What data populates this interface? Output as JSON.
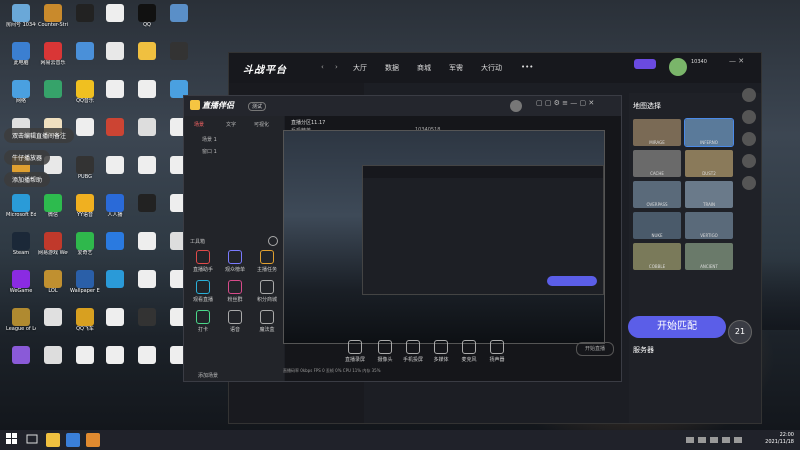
{
  "desktop": {
    "icons": [
      {
        "label": "房间号 10340",
        "color": "#6aa8d8"
      },
      {
        "label": "Counter-Strike Global Off.",
        "color": "#c98a2c"
      },
      {
        "label": "",
        "color": "#222"
      },
      {
        "label": "",
        "color": "#eee"
      },
      {
        "label": "QQ",
        "color": "#111"
      },
      {
        "label": "",
        "color": "#5a8fc8"
      },
      {
        "label": "此电脑",
        "color": "#3b7fd1"
      },
      {
        "label": "网易云音乐",
        "color": "#d93636"
      },
      {
        "label": "",
        "color": "#4a90d9"
      },
      {
        "label": "",
        "color": "#e8e8e8"
      },
      {
        "label": "",
        "color": "#f0c040"
      },
      {
        "label": "",
        "color": "#333"
      },
      {
        "label": "网络",
        "color": "#4aa0e0"
      },
      {
        "label": "",
        "color": "#36a36a"
      },
      {
        "label": "QQ音乐",
        "color": "#f0c020"
      },
      {
        "label": "",
        "color": "#eee"
      },
      {
        "label": "",
        "color": "#eee"
      },
      {
        "label": "",
        "color": "#4aa0e0"
      },
      {
        "label": "",
        "color": "#e0e0e0"
      },
      {
        "label": "",
        "color": "#f0e0c0"
      },
      {
        "label": "",
        "color": "#eee"
      },
      {
        "label": "",
        "color": "#c43"
      },
      {
        "label": "",
        "color": "#ddd"
      },
      {
        "label": "",
        "color": "#eee"
      },
      {
        "label": "",
        "color": "#e0a030"
      },
      {
        "label": "",
        "color": "#e8e8e8"
      },
      {
        "label": "PUBG",
        "color": "#333"
      },
      {
        "label": "",
        "color": "#eee"
      },
      {
        "label": "",
        "color": "#eee"
      },
      {
        "label": "",
        "color": "#eee"
      },
      {
        "label": "Microsoft Edge",
        "color": "#2a9bd8"
      },
      {
        "label": "微信",
        "color": "#2dbb4e"
      },
      {
        "label": "YY语音",
        "color": "#f0b020"
      },
      {
        "label": "人人播",
        "color": "#2a6ad8"
      },
      {
        "label": "",
        "color": "#222"
      },
      {
        "label": "",
        "color": "#eee"
      },
      {
        "label": "Steam",
        "color": "#1b2838"
      },
      {
        "label": "网易游戏 WeGame",
        "color": "#c0392b"
      },
      {
        "label": "爱奇艺",
        "color": "#2fb84c"
      },
      {
        "label": "",
        "color": "#2a7ae0"
      },
      {
        "label": "",
        "color": "#eee"
      },
      {
        "label": "",
        "color": "#ddd"
      },
      {
        "label": "WeGame",
        "color": "#8a2be2"
      },
      {
        "label": "LOL",
        "color": "#c09030"
      },
      {
        "label": "Wallpaper Engine",
        "color": "#2a5fa8"
      },
      {
        "label": "",
        "color": "#2a9ad8"
      },
      {
        "label": "",
        "color": "#eee"
      },
      {
        "label": "",
        "color": "#eee"
      },
      {
        "label": "League of Legends",
        "color": "#b08a30"
      },
      {
        "label": "",
        "color": "#e0e0e0"
      },
      {
        "label": "QQ飞车",
        "color": "#d8a020"
      },
      {
        "label": "",
        "color": "#eee"
      },
      {
        "label": "",
        "color": "#333"
      },
      {
        "label": "",
        "color": "#eee"
      },
      {
        "label": "",
        "color": "#8a5ad8"
      },
      {
        "label": "",
        "color": "#ddd"
      },
      {
        "label": "",
        "color": "#eee"
      },
      {
        "label": "",
        "color": "#eee"
      },
      {
        "label": "",
        "color": "#eee"
      },
      {
        "label": "",
        "color": "#eee"
      }
    ],
    "notes": [
      "双击编辑直播间备注",
      "牛仔播放器",
      "添加播帮助"
    ]
  },
  "huya": {
    "logo": "斗战平台",
    "nav": [
      "大厅",
      "数据",
      "商城",
      "军需",
      "大行动"
    ],
    "more": "•••",
    "user": "10340",
    "right": {
      "map_title": "地图选择",
      "maps": [
        "MIRAGE",
        "INFERNO",
        "CACHE",
        "DUST2",
        "OVERPASS",
        "TRAIN",
        "NUKE",
        "VERTIGO",
        "COBBLE",
        "ANCIENT"
      ],
      "server_title": "服务器",
      "match_button": "开始匹配",
      "badge": "21"
    }
  },
  "zbpt": {
    "logo": "直播伴侣",
    "tag": "测试",
    "side_tabs": [
      "场景",
      "文字",
      "可视化"
    ],
    "scenes": [
      "场景 1",
      "窗口 1"
    ],
    "toolbar_left": [
      "直播助手",
      "观众榜单",
      "主播任务",
      "观看直播",
      "粉丝群",
      "积分商城",
      "打卡",
      "语音",
      "魔法盒"
    ],
    "add_label": "添加场景",
    "title": "直播分区11.17",
    "game": "反恐精英",
    "room": "10340518",
    "bottom_buttons": [
      "直播录屏",
      "摄像头",
      "手机投屏",
      "多媒体",
      "麦克风",
      "扬声器"
    ],
    "start_button": "开始直播",
    "status": "直播码率 0kbps  FPS 0  丢帧 0%  CPU 11%  内存 35%"
  },
  "taskbar": {
    "time": "22:00",
    "date": "2021/11/18"
  }
}
